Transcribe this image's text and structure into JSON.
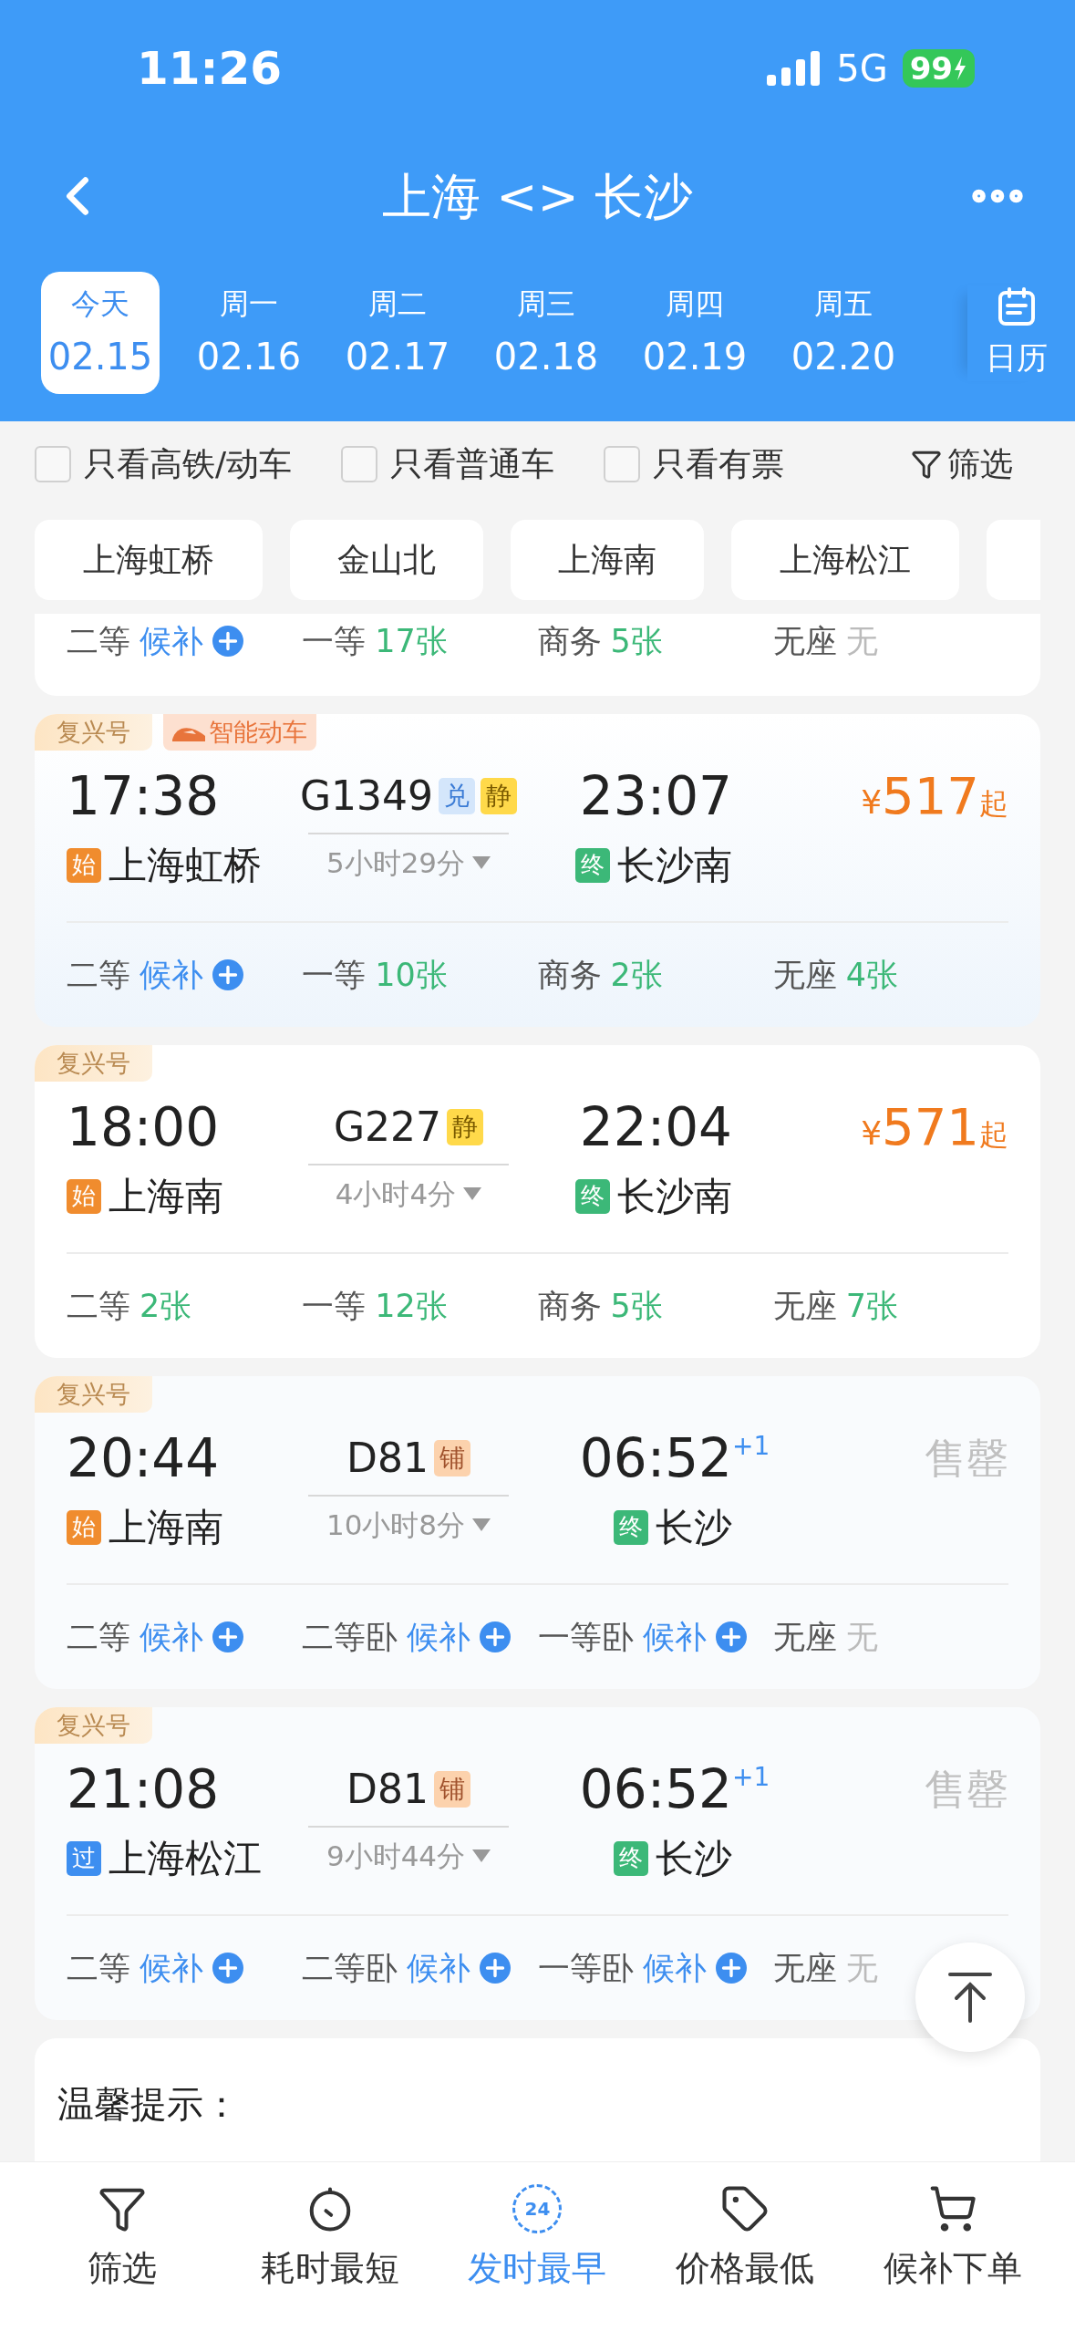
{
  "status_bar": {
    "time": "11:26",
    "network": "5G",
    "battery": "99"
  },
  "nav": {
    "title": "上海 <> 长沙"
  },
  "dates": [
    {
      "weekday": "今天",
      "date": "02.15",
      "selected": true
    },
    {
      "weekday": "周一",
      "date": "02.16",
      "selected": false
    },
    {
      "weekday": "周二",
      "date": "02.17",
      "selected": false
    },
    {
      "weekday": "周三",
      "date": "02.18",
      "selected": false
    },
    {
      "weekday": "周四",
      "date": "02.19",
      "selected": false
    },
    {
      "weekday": "周五",
      "date": "02.20",
      "selected": false
    }
  ],
  "calendar": {
    "label": "日历"
  },
  "filters": [
    {
      "label": "只看高铁/动车",
      "checked": false
    },
    {
      "label": "只看普通车",
      "checked": false
    },
    {
      "label": "只看有票",
      "checked": false
    }
  ],
  "filter_button": {
    "label": "筛选"
  },
  "stations": [
    {
      "label": "上海虹桥"
    },
    {
      "label": "金山北"
    },
    {
      "label": "上海南"
    },
    {
      "label": "上海松江"
    }
  ],
  "partial_card": {
    "seats": [
      {
        "class": "二等",
        "value": "候补",
        "kind": "waitlist"
      },
      {
        "class": "一等",
        "value": "17张",
        "kind": "available"
      },
      {
        "class": "商务",
        "value": "5张",
        "kind": "available"
      },
      {
        "class": "无座",
        "value": "无",
        "kind": "none"
      }
    ]
  },
  "trains": [
    {
      "tags": [
        {
          "label": "复兴号",
          "kind": "brand"
        },
        {
          "label": "智能动车",
          "kind": "smart"
        }
      ],
      "depart": "17:38",
      "train_no": "G1349",
      "badges": [
        {
          "label": "兑",
          "kind": "exchange"
        },
        {
          "label": "静",
          "kind": "quiet"
        }
      ],
      "arrive": "23:07",
      "from": {
        "mark": "始",
        "kind": "origin",
        "name": "上海虹桥"
      },
      "duration": "5小时29分",
      "to": {
        "mark": "终",
        "kind": "terminal",
        "name": "长沙南"
      },
      "fare": {
        "kind": "price",
        "symbol": "¥",
        "amount": "517",
        "suffix": "起"
      },
      "seats": [
        {
          "class": "二等",
          "value": "候补",
          "kind": "waitlist"
        },
        {
          "class": "一等",
          "value": "10张",
          "kind": "available"
        },
        {
          "class": "商务",
          "value": "2张",
          "kind": "available"
        },
        {
          "class": "无座",
          "value": "4张",
          "kind": "available"
        }
      ]
    },
    {
      "tags": [
        {
          "label": "复兴号",
          "kind": "brand"
        }
      ],
      "depart": "18:00",
      "train_no": "G227",
      "badges": [
        {
          "label": "静",
          "kind": "quiet"
        }
      ],
      "arrive": "22:04",
      "from": {
        "mark": "始",
        "kind": "origin",
        "name": "上海南"
      },
      "duration": "4小时4分",
      "to": {
        "mark": "终",
        "kind": "terminal",
        "name": "长沙南"
      },
      "fare": {
        "kind": "price",
        "symbol": "¥",
        "amount": "571",
        "suffix": "起"
      },
      "seats": [
        {
          "class": "二等",
          "value": "2张",
          "kind": "available"
        },
        {
          "class": "一等",
          "value": "12张",
          "kind": "available"
        },
        {
          "class": "商务",
          "value": "5张",
          "kind": "available"
        },
        {
          "class": "无座",
          "value": "7张",
          "kind": "available"
        }
      ]
    },
    {
      "tags": [
        {
          "label": "复兴号",
          "kind": "brand"
        }
      ],
      "depart": "20:44",
      "train_no": "D81",
      "badges": [
        {
          "label": "铺",
          "kind": "sleeper"
        }
      ],
      "arrive": "06:52",
      "next_day": "+1",
      "from": {
        "mark": "始",
        "kind": "origin",
        "name": "上海南"
      },
      "duration": "10小时8分",
      "to": {
        "mark": "终",
        "kind": "terminal",
        "name": "长沙"
      },
      "fare": {
        "kind": "sold_out",
        "label": "售罄"
      },
      "seats": [
        {
          "class": "二等",
          "value": "候补",
          "kind": "waitlist"
        },
        {
          "class": "二等卧",
          "value": "候补",
          "kind": "waitlist"
        },
        {
          "class": "一等卧",
          "value": "候补",
          "kind": "waitlist"
        },
        {
          "class": "无座",
          "value": "无",
          "kind": "none"
        }
      ]
    },
    {
      "tags": [
        {
          "label": "复兴号",
          "kind": "brand"
        }
      ],
      "depart": "21:08",
      "train_no": "D81",
      "badges": [
        {
          "label": "铺",
          "kind": "sleeper"
        }
      ],
      "arrive": "06:52",
      "next_day": "+1",
      "from": {
        "mark": "过",
        "kind": "pass",
        "name": "上海松江"
      },
      "duration": "9小时44分",
      "to": {
        "mark": "终",
        "kind": "terminal",
        "name": "长沙"
      },
      "fare": {
        "kind": "sold_out",
        "label": "售罄"
      },
      "seats": [
        {
          "class": "二等",
          "value": "候补",
          "kind": "waitlist"
        },
        {
          "class": "二等卧",
          "value": "候补",
          "kind": "waitlist"
        },
        {
          "class": "一等卧",
          "value": "候补",
          "kind": "waitlist"
        },
        {
          "class": "无座",
          "value": "无",
          "kind": "none"
        }
      ]
    }
  ],
  "tip": {
    "title": "温馨提示："
  },
  "bottom_tabs": [
    {
      "label": "筛选",
      "kind": "filter",
      "selected": false
    },
    {
      "label": "耗时最短",
      "kind": "timer",
      "selected": false
    },
    {
      "label": "发时最早",
      "kind": "clock24",
      "icon_text": "24",
      "selected": true
    },
    {
      "label": "价格最低",
      "kind": "tag",
      "selected": false
    },
    {
      "label": "候补下单",
      "kind": "cart",
      "selected": false
    }
  ]
}
